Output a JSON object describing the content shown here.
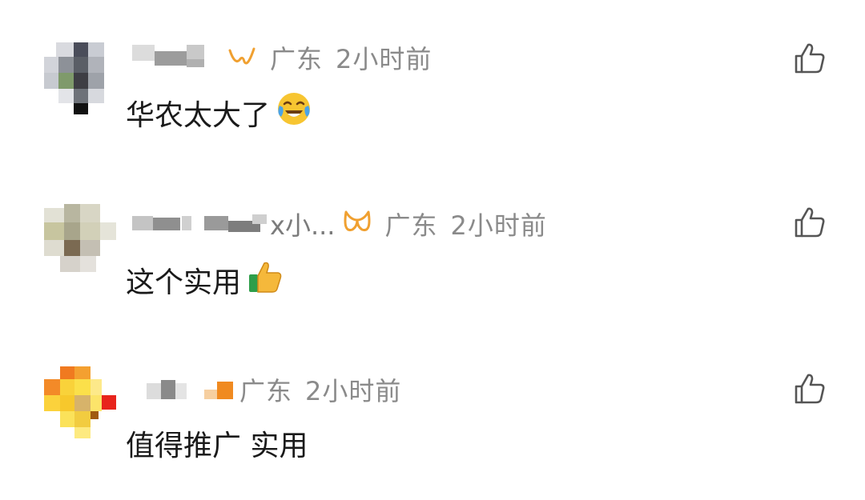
{
  "comments": [
    {
      "name_tail": "",
      "location": "广东",
      "time": "2小时前",
      "text": "华农太大了",
      "emoji_icon": "face-with-tears-of-joy-icon",
      "badge_color": "#f0a030"
    },
    {
      "name_tail": "x小...",
      "location": "广东",
      "time": "2小时前",
      "text": "这个实用",
      "emoji_icon": "thumbs-up-icon",
      "badge_color": "#f0a030"
    },
    {
      "name_tail": "",
      "location": "广东",
      "time": "2小时前",
      "text": "值得推广 实用",
      "emoji_icon": "",
      "badge_color": ""
    }
  ],
  "colors": {
    "meta_text": "#8a8a8a",
    "body_text": "#1a1a1a",
    "like_icon": "#555555"
  }
}
